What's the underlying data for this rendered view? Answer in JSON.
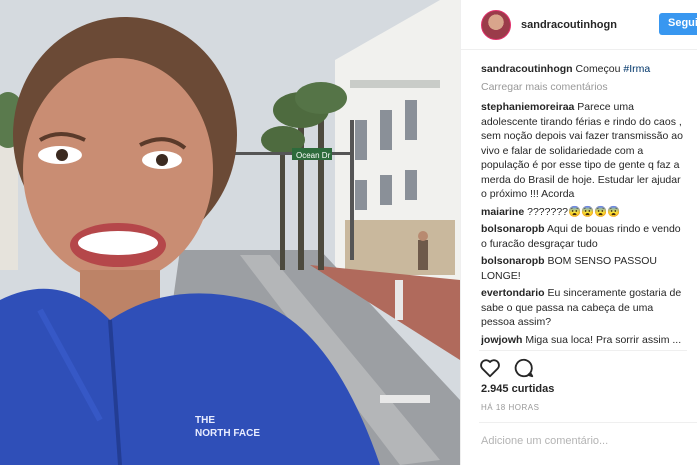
{
  "post": {
    "author": "sandracoutinhogn",
    "follow_label": "Seguir"
  },
  "caption": {
    "user": "sandracoutinhogn",
    "text": "Começou",
    "hashtag": "#Irma"
  },
  "load_more": "Carregar mais comentários",
  "comments": [
    {
      "user": "stephaniemoreiraa",
      "text": "Parece uma adolescente tirando férias e rindo do caos , sem noção depois vai fazer transmissão ao vivo e falar de solidariedade com a população é por esse tipo de gente q faz a merda do Brasil de hoje. Estudar ler ajudar o próximo !!! Acorda"
    },
    {
      "user": "maiarine",
      "text": "???????😨😨😨😨"
    },
    {
      "user": "bolsonaropb",
      "text": "Aqui de bouas rindo e vendo o furacão desgraçar tudo"
    },
    {
      "user": "bolsonaropb",
      "text": "BOM SENSO PASSOU LONGE!"
    },
    {
      "user": "evertondario",
      "text": "Eu sinceramente gostaria de sabe o que passa na cabeça de uma pessoa assim?"
    },
    {
      "user": "jowjowh",
      "text": "Miga sua loca! Pra sorrir assim ... Deus"
    }
  ],
  "stats": {
    "likes": "2.945 curtidas",
    "time": "HÁ 18 HORAS"
  },
  "add_comment_placeholder": "Adicione um comentário...",
  "photo": {
    "street_sign": "Ocean Dr",
    "jacket_brand": "THE NORTH FACE"
  },
  "icons": [
    "heart-icon",
    "comment-icon"
  ],
  "colors": {
    "follow": "#3897f0",
    "jacket": "#2f4fb8",
    "hashtag": "#003569"
  }
}
